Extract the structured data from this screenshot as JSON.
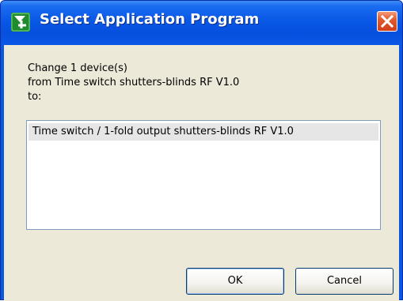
{
  "window": {
    "title": "Select Application Program",
    "icon": "ets-logo-icon",
    "title_color": "#ffffff",
    "titlebar_color": "#0a56e6",
    "close_icon": "close-icon"
  },
  "message": {
    "line1": "Change 1 device(s)",
    "line2": "from Time switch shutters-blinds RF V1.0",
    "line3": "to:"
  },
  "list": {
    "items": [
      {
        "label": "Time switch / 1-fold output shutters-blinds RF V1.0",
        "selected": true
      }
    ]
  },
  "buttons": {
    "ok_label": "OK",
    "cancel_label": "Cancel"
  }
}
